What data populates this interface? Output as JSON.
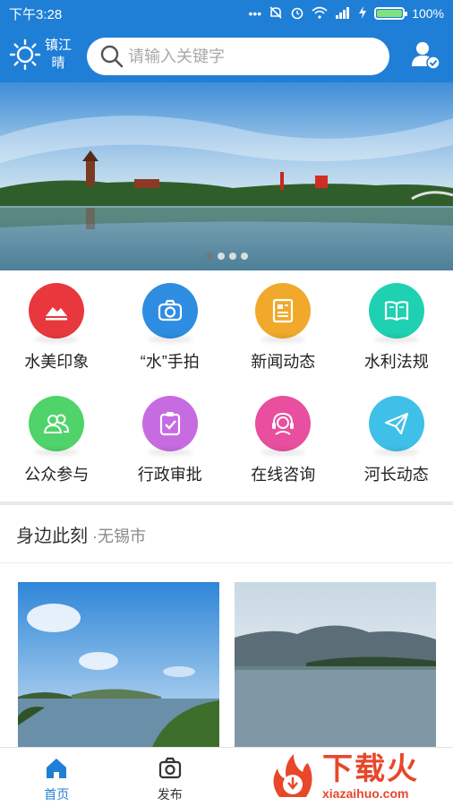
{
  "status_bar": {
    "time": "下午3:28",
    "battery_text": "100%",
    "battery_level": 1.0,
    "icons": [
      "dots-icon",
      "mute-icon",
      "alarm-icon",
      "wifi-icon",
      "signal-icon",
      "charging-icon",
      "battery-icon"
    ]
  },
  "header": {
    "weather": {
      "city": "镇江",
      "condition": "晴",
      "icon": "sun-icon"
    },
    "search": {
      "placeholder": "请输入关键字",
      "icon": "search-icon"
    },
    "user_icon": "user-verified-icon"
  },
  "banner": {
    "slides": 4,
    "active_index": 0
  },
  "features": [
    {
      "label": "水美印象",
      "icon": "mountain-icon",
      "color": "#e8383d"
    },
    {
      "label": "“水”手拍",
      "icon": "camera-icon",
      "color": "#2e8de0"
    },
    {
      "label": "新闻动态",
      "icon": "news-icon",
      "color": "#f0a92b"
    },
    {
      "label": "水利法规",
      "icon": "book-icon",
      "color": "#1fd1b0"
    },
    {
      "label": "公众参与",
      "icon": "people-icon",
      "color": "#4fd36a"
    },
    {
      "label": "行政审批",
      "icon": "approval-icon",
      "color": "#c76be0"
    },
    {
      "label": "在线咨询",
      "icon": "headset-icon",
      "color": "#e84f9e"
    },
    {
      "label": "河长动态",
      "icon": "paper-plane-icon",
      "color": "#3fc0e8"
    }
  ],
  "nearby": {
    "title": "身边此刻",
    "separator": " ·",
    "city": "无锡市"
  },
  "bottom_nav": [
    {
      "label": "首页",
      "icon": "home-icon",
      "active": true
    },
    {
      "label": "发布",
      "icon": "camera-icon",
      "active": false
    },
    {
      "label": "",
      "icon": "",
      "active": false
    },
    {
      "label": "",
      "icon": "",
      "active": false
    }
  ],
  "watermark": {
    "text": "下载火",
    "url": "xiazaihuo.com"
  },
  "colors": {
    "primary": "#1f7fd6",
    "active_nav": "#1f7fd6",
    "watermark": "#e8472a"
  }
}
